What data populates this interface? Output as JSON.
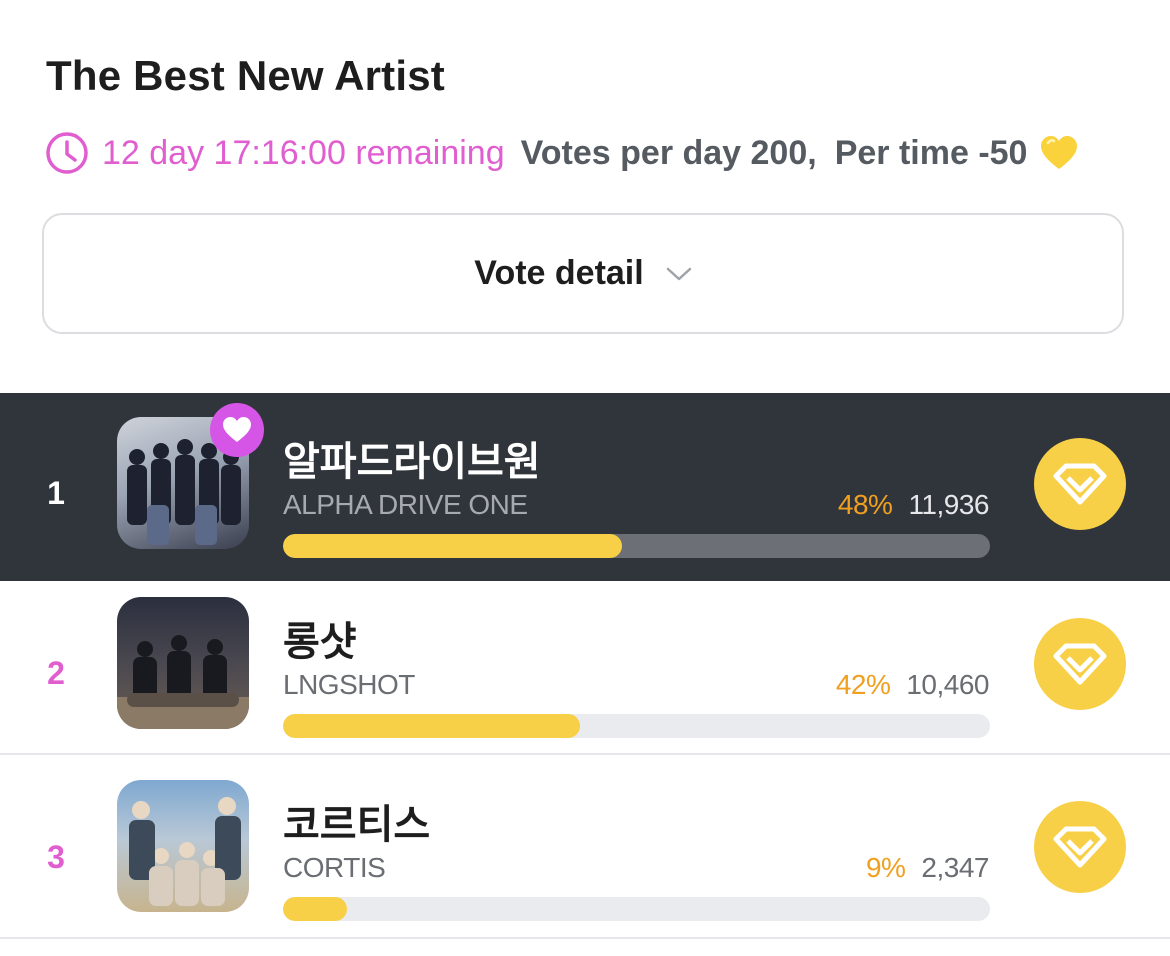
{
  "header": {
    "title": "The Best New Artist",
    "remaining": "12 day 17:16:00 remaining",
    "votes_per_day": "Votes per day 200,",
    "per_time": "Per time -50"
  },
  "vote_detail": {
    "label": "Vote detail"
  },
  "icons": {
    "clock": "clock-icon",
    "heart": "yellow-heart-icon",
    "chevron": "chevron-down-icon",
    "favorite": "heart-icon",
    "vote": "vote-logo-icon"
  },
  "colors": {
    "accent": "#e05ed0",
    "bar_fill": "#f7d047",
    "percent": "#f0a020",
    "top_row_bg": "#30343b"
  },
  "ranking": [
    {
      "rank": "1",
      "name_ko": "알파드라이브원",
      "name_en": "ALPHA DRIVE ONE",
      "percent_label": "48%",
      "votes": "11,936",
      "share": 0.48,
      "favorite": true
    },
    {
      "rank": "2",
      "name_ko": "롱샷",
      "name_en": "LNGSHOT",
      "percent_label": "42%",
      "votes": "10,460",
      "share": 0.42,
      "favorite": false
    },
    {
      "rank": "3",
      "name_ko": "코르티스",
      "name_en": "CORTIS",
      "percent_label": "9%",
      "votes": "2,347",
      "share": 0.09,
      "favorite": false
    }
  ]
}
